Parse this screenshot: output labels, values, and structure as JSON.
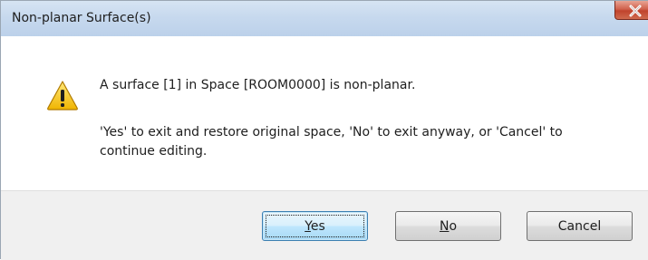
{
  "window": {
    "title": "Non-planar Surface(s)",
    "close_icon": "close-icon",
    "close_color": "#c0432d"
  },
  "message": {
    "icon": "warning-icon",
    "line1": "A surface [1] in Space [ROOM0000] is non-planar.",
    "line2": "'Yes' to exit and restore original space, 'No' to exit anyway, or 'Cancel' to continue editing."
  },
  "buttons": {
    "yes": {
      "mnemonic": "Y",
      "rest": "es"
    },
    "no": {
      "mnemonic": "N",
      "rest": "o"
    },
    "cancel": {
      "label": "Cancel"
    }
  }
}
